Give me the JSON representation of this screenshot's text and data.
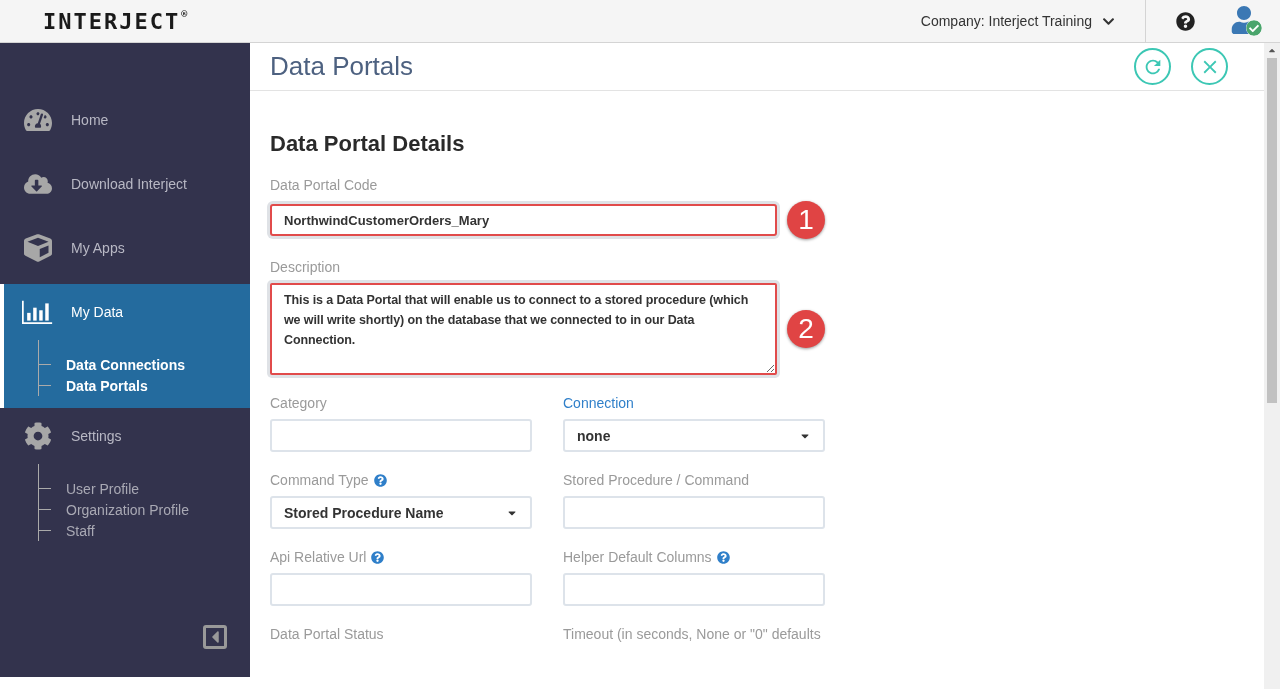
{
  "header": {
    "logo": "INTERJECT",
    "logo_mark": "®",
    "company": "Company: Interject Training"
  },
  "sidebar": {
    "items": [
      {
        "label": "Home",
        "kind": "gauge",
        "selected": false
      },
      {
        "label": "Download Interject",
        "kind": "cloud",
        "selected": false
      },
      {
        "label": "My Apps",
        "kind": "cube",
        "selected": false
      },
      {
        "label": "My Data",
        "kind": "chart",
        "selected": true,
        "children": [
          {
            "label": "Data Connections"
          },
          {
            "label": "Data Portals"
          }
        ]
      },
      {
        "label": "Settings",
        "kind": "gear",
        "selected": false,
        "children": [
          {
            "label": "User Profile"
          },
          {
            "label": "Organization Profile"
          },
          {
            "label": "Staff"
          }
        ]
      }
    ]
  },
  "page": {
    "title": "Data Portals"
  },
  "form": {
    "title": "Data Portal Details",
    "fields": [
      {
        "label": "Data Portal Code",
        "kind": "text",
        "value": "NorthwindCustomerOrders_Mary",
        "wide": true,
        "annotation": "1"
      },
      {
        "label": "Description",
        "kind": "textarea",
        "value": "This is a Data Portal that will enable us to connect to a stored procedure (which we will write shortly) on the database that we connected to in our Data Connection.",
        "wide": true,
        "annotation": "2"
      },
      {
        "label": "Category",
        "kind": "text",
        "wide": false
      },
      {
        "label": "Connection",
        "kind": "select",
        "value": "none",
        "wide": false,
        "focused": true
      },
      {
        "label": "Command Type",
        "kind": "select",
        "value": "Stored Procedure Name",
        "wide": false,
        "help": true
      },
      {
        "label": "Stored Procedure / Command",
        "kind": "text",
        "wide": false
      },
      {
        "label": "Api Relative Url",
        "kind": "text",
        "wide": false,
        "help": true
      },
      {
        "label": "Helper Default Columns",
        "kind": "text",
        "wide": false,
        "help": true
      },
      {
        "label": "Data Portal Status",
        "kind": "label",
        "wide": false
      },
      {
        "label": "Timeout (in seconds, None or \"0\" defaults",
        "kind": "label",
        "wide": false
      }
    ]
  }
}
